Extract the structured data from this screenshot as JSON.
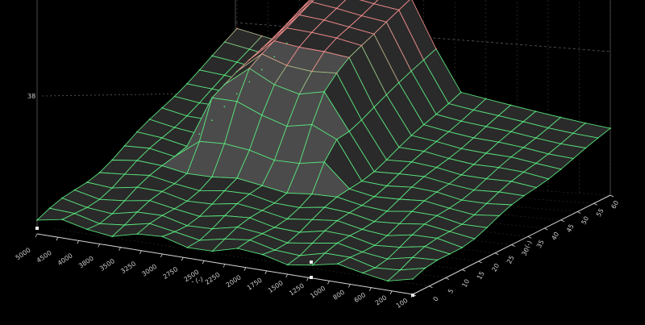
{
  "chart_data": {
    "type": "surface",
    "z_marker_label": "38",
    "x_axis": {
      "label": "- (-)",
      "ticks": [
        "5000",
        "4500",
        "4000",
        "3800",
        "3500",
        "3250",
        "3000",
        "2750",
        "2500",
        "2250",
        "2000",
        "1750",
        "1500",
        "1250",
        "1000",
        "800",
        "600",
        "200",
        "100"
      ]
    },
    "y_axis": {
      "label": "- (-)",
      "ticks": [
        "0",
        "5",
        "10",
        "15",
        "20",
        "25",
        "30",
        "35",
        "40",
        "45",
        "50",
        "55",
        "60"
      ]
    },
    "colors": {
      "background": "#000000",
      "surface_fill": "#2a2a2a",
      "surface_fill_raised": "#4b4b4b",
      "grid_low": "#57e07a",
      "grid_high": "#f08a8a",
      "axis": "#d8d8d8",
      "guide": "#5e5e5e"
    }
  }
}
